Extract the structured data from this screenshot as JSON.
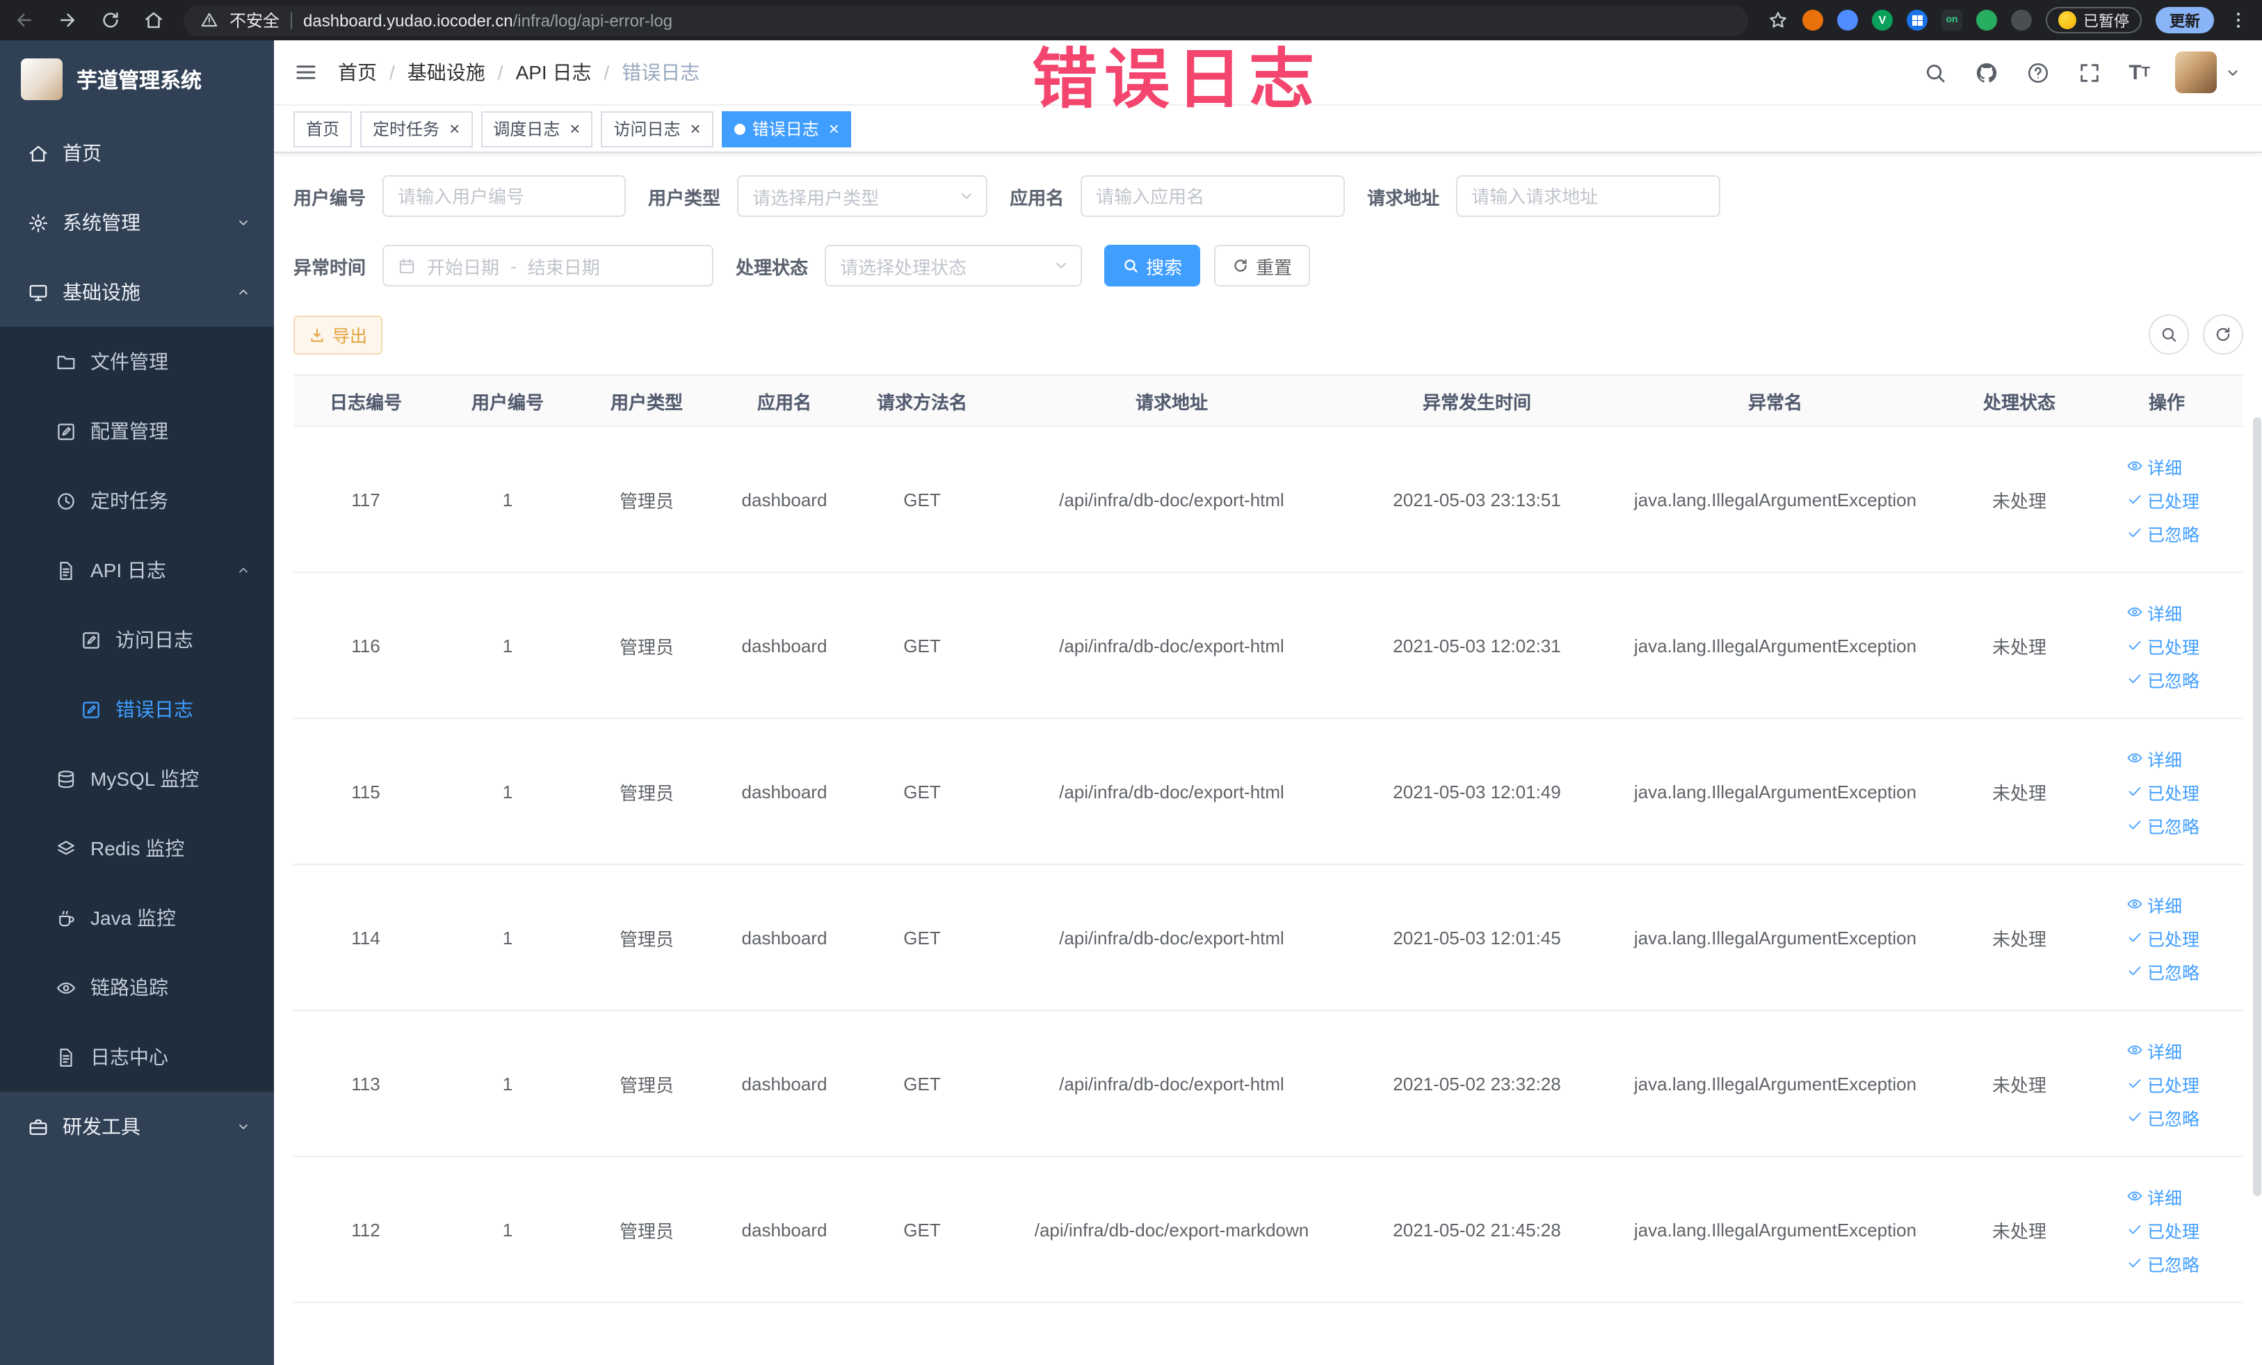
{
  "theme": {
    "accent": "#409eff",
    "sidebar_bg": "#304156",
    "submenu_bg": "#1f2d3d",
    "annotation_color": "#f4456e",
    "warning_button": "#e6a23c"
  },
  "browser": {
    "security_label": "不安全",
    "url_domain": "dashboard.yudao.iocoder.cn",
    "url_path": "/infra/log/api-error-log",
    "ext_badge_on": "on",
    "paused_badge": "已暂停",
    "update_button": "更新"
  },
  "annotation": {
    "text": "错误日志"
  },
  "sidebar": {
    "title": "芋道管理系统",
    "menu": [
      {
        "key": "home",
        "label": "首页",
        "icon": "home",
        "level": 1
      },
      {
        "key": "system-mgmt",
        "label": "系统管理",
        "icon": "gear",
        "level": 1,
        "arrow": "down"
      },
      {
        "key": "infrastructure",
        "label": "基础设施",
        "icon": "monitor",
        "level": 1,
        "arrow": "up"
      },
      {
        "key": "file-mgmt",
        "label": "文件管理",
        "icon": "folder",
        "level": 2
      },
      {
        "key": "config-mgmt",
        "label": "配置管理",
        "icon": "edit",
        "level": 2
      },
      {
        "key": "scheduled-task",
        "label": "定时任务",
        "icon": "clock",
        "level": 2
      },
      {
        "key": "api-log",
        "label": "API 日志",
        "icon": "document",
        "level": 2,
        "arrow": "up"
      },
      {
        "key": "access-log",
        "label": "访问日志",
        "icon": "edit-square",
        "level": 3
      },
      {
        "key": "error-log",
        "label": "错误日志",
        "icon": "edit-square",
        "level": 3,
        "active": true
      },
      {
        "key": "mysql-monitor",
        "label": "MySQL 监控",
        "icon": "database",
        "level": 2
      },
      {
        "key": "redis-monitor",
        "label": "Redis 监控",
        "icon": "layers",
        "level": 2
      },
      {
        "key": "java-monitor",
        "label": "Java 监控",
        "icon": "coffee",
        "level": 2
      },
      {
        "key": "link-trace",
        "label": "链路追踪",
        "icon": "eye",
        "level": 2
      },
      {
        "key": "log-center",
        "label": "日志中心",
        "icon": "doc-text",
        "level": 2
      },
      {
        "key": "dev-tools",
        "label": "研发工具",
        "icon": "toolbox",
        "level": 1,
        "arrow": "down"
      }
    ]
  },
  "navbar": {
    "breadcrumb": [
      "首页",
      "基础设施",
      "API 日志",
      "错误日志"
    ],
    "breadcrumb_separator": "/"
  },
  "tags_view": [
    {
      "key": "home",
      "label": "首页",
      "closable": false,
      "active": false
    },
    {
      "key": "scheduled-task",
      "label": "定时任务",
      "closable": true,
      "active": false
    },
    {
      "key": "schedule-log",
      "label": "调度日志",
      "closable": true,
      "active": false
    },
    {
      "key": "access-log",
      "label": "访问日志",
      "closable": true,
      "active": false
    },
    {
      "key": "error-log",
      "label": "错误日志",
      "closable": true,
      "active": true
    }
  ],
  "filters": {
    "user_id": {
      "label": "用户编号",
      "placeholder": "请输入用户编号"
    },
    "user_type": {
      "label": "用户类型",
      "placeholder": "请选择用户类型"
    },
    "app_name": {
      "label": "应用名",
      "placeholder": "请输入应用名"
    },
    "request_url": {
      "label": "请求地址",
      "placeholder": "请输入请求地址"
    },
    "exception_time": {
      "label": "异常时间",
      "start_placeholder": "开始日期",
      "separator": "-",
      "end_placeholder": "结束日期"
    },
    "process_status": {
      "label": "处理状态",
      "placeholder": "请选择处理状态"
    },
    "search_button": "搜索",
    "reset_button": "重置"
  },
  "toolbar": {
    "export_label": "导出"
  },
  "table": {
    "columns": [
      "日志编号",
      "用户编号",
      "用户类型",
      "应用名",
      "请求方法名",
      "请求地址",
      "异常发生时间",
      "异常名",
      "处理状态",
      "操作"
    ],
    "action_labels": [
      "详细",
      "已处理",
      "已忽略"
    ],
    "rows": [
      {
        "id": "117",
        "user_id": "1",
        "user_type": "管理员",
        "app": "dashboard",
        "method": "GET",
        "url": "/api/infra/db-doc/export-html",
        "time": "2021-05-03 23:13:51",
        "exception": "java.lang.IllegalArgumentException",
        "status": "未处理"
      },
      {
        "id": "116",
        "user_id": "1",
        "user_type": "管理员",
        "app": "dashboard",
        "method": "GET",
        "url": "/api/infra/db-doc/export-html",
        "time": "2021-05-03 12:02:31",
        "exception": "java.lang.IllegalArgumentException",
        "status": "未处理"
      },
      {
        "id": "115",
        "user_id": "1",
        "user_type": "管理员",
        "app": "dashboard",
        "method": "GET",
        "url": "/api/infra/db-doc/export-html",
        "time": "2021-05-03 12:01:49",
        "exception": "java.lang.IllegalArgumentException",
        "status": "未处理"
      },
      {
        "id": "114",
        "user_id": "1",
        "user_type": "管理员",
        "app": "dashboard",
        "method": "GET",
        "url": "/api/infra/db-doc/export-html",
        "time": "2021-05-03 12:01:45",
        "exception": "java.lang.IllegalArgumentException",
        "status": "未处理"
      },
      {
        "id": "113",
        "user_id": "1",
        "user_type": "管理员",
        "app": "dashboard",
        "method": "GET",
        "url": "/api/infra/db-doc/export-html",
        "time": "2021-05-02 23:32:28",
        "exception": "java.lang.IllegalArgumentException",
        "status": "未处理"
      },
      {
        "id": "112",
        "user_id": "1",
        "user_type": "管理员",
        "app": "dashboard",
        "method": "GET",
        "url": "/api/infra/db-doc/export-markdown",
        "time": "2021-05-02 21:45:28",
        "exception": "java.lang.IllegalArgumentException",
        "status": "未处理"
      }
    ]
  }
}
